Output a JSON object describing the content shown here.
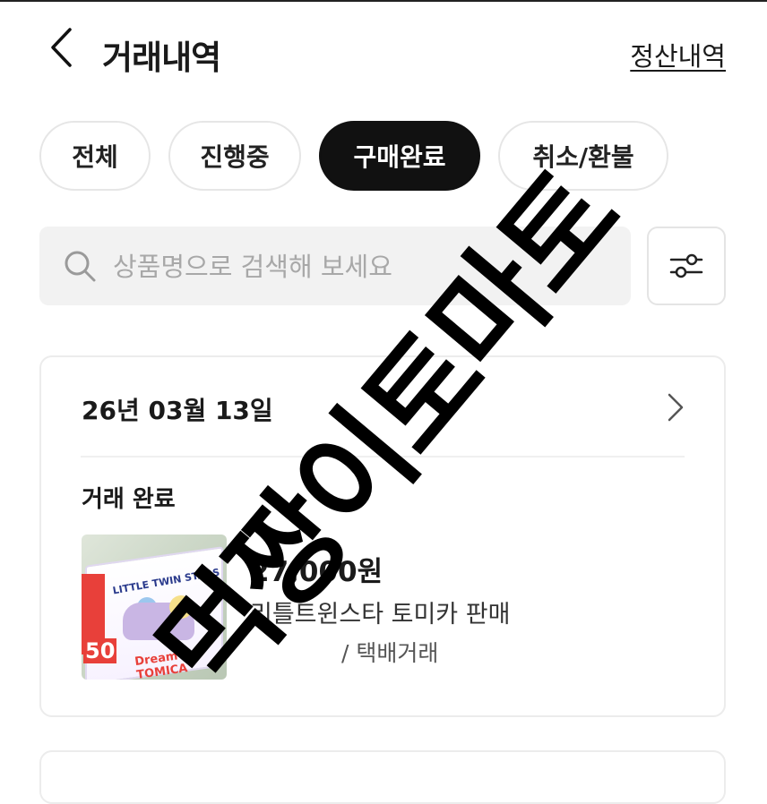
{
  "header": {
    "title": "거래내역",
    "settlement_link": "정산내역"
  },
  "tabs": [
    {
      "label": "전체",
      "active": false
    },
    {
      "label": "진행중",
      "active": false
    },
    {
      "label": "구매완료",
      "active": true
    },
    {
      "label": "취소/환불",
      "active": false
    }
  ],
  "search": {
    "placeholder": "상품명으로 검색해 보세요",
    "value": ""
  },
  "icons": {
    "back": "chevron-left-icon",
    "search": "search-icon",
    "filter": "sliders-icon",
    "detail": "chevron-right-icon"
  },
  "transactions": [
    {
      "date": "26년 03월 13일",
      "status": "거래 완료",
      "price": "27,000원",
      "product_name": "리틀트윈스타 토미카 판매",
      "trade_type": "/ 택배거래",
      "thumbnail_text": [
        "LITTLE TWIN STARS",
        "50",
        "Dream TOMICA"
      ]
    }
  ],
  "watermark": "먹짱이토마토",
  "colors": {
    "active_tab_bg": "#111111",
    "active_tab_text": "#ffffff",
    "search_bg": "#f2f2f2",
    "border": "#ececec"
  }
}
